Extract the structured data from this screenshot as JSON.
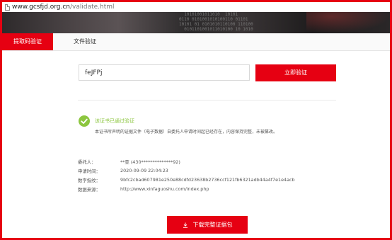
{
  "browser": {
    "url_host": "www.gcsfjd.org.cn",
    "url_path": "/validate.html"
  },
  "banner": {
    "binary_lines": [
      "  10101001011010  10101 ",
      "0110 0101001010100110 01101",
      "10101 01 0101010110100 110100",
      "  0101101001011010100 10 1010"
    ]
  },
  "tabs": [
    {
      "label": "提取码验证",
      "active": true
    },
    {
      "label": "文件验证",
      "active": false
    }
  ],
  "form": {
    "code_value": "feJFPj",
    "verify_label": "立即验证"
  },
  "result": {
    "status": "该证书已通过验证",
    "description": "本证书所声明的证据文件（电子数据）自委托人申请时间起已经存在，内容保持完整，未被篡改。",
    "status_color": "#8cc63f"
  },
  "details": [
    {
      "label": "委托人：",
      "value": "**亚 (430**************92)"
    },
    {
      "label": "申请时间：",
      "value": "2020-09-09 22:04:23"
    },
    {
      "label": "数字指纹：",
      "value": "9bfc2cbad607981e250e88cdfd23638b2736ccf121fb6321adb44a4f7e1e4acb"
    },
    {
      "label": "数据来源：",
      "value": "http://www.xinfaguoshu.com/index.php"
    }
  ],
  "download": {
    "label": "下载完整证据包"
  },
  "colors": {
    "accent": "#e60012"
  },
  "icons": {
    "page": "page-icon",
    "check": "check-circle-icon",
    "download": "download-icon"
  }
}
